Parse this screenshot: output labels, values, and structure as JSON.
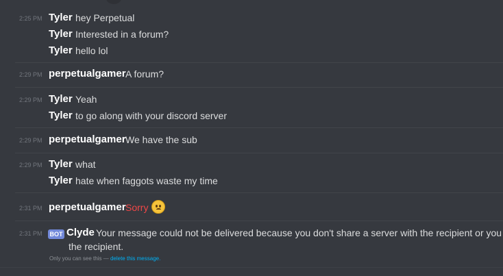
{
  "messages": [
    {
      "time": "2:25 PM",
      "author": "Tyler",
      "lines": [
        "hey Perpetual",
        "Interested in a forum?",
        "hello lol"
      ]
    },
    {
      "time": "2:29 PM",
      "author": "perpetualgamer",
      "lines": [
        "A forum?"
      ]
    },
    {
      "time": "2:29 PM",
      "author": "Tyler",
      "lines": [
        "Yeah",
        "to go along with your discord server"
      ]
    },
    {
      "time": "2:29 PM",
      "author": "perpetualgamer",
      "lines": [
        "We have the sub"
      ]
    },
    {
      "time": "2:29 PM",
      "author": "Tyler",
      "lines": [
        "what",
        "hate when faggots waste my time"
      ]
    },
    {
      "time": "2:31 PM",
      "author": "perpetualgamer",
      "lines": [
        "Sorry"
      ],
      "emoji": "worried-face-emoji",
      "text_color": "#f04747"
    },
    {
      "time": "2:31 PM",
      "author": "Clyde",
      "badge": "BOT",
      "lines": [
        "Your message could not be delivered because you don't share a server with the recipient or you",
        "the recipient."
      ],
      "ephemeral_note": "Only you can see this —",
      "ephemeral_link": "delete this message."
    }
  ],
  "colors": {
    "background": "#36393f",
    "author": "#ffffff",
    "text": "#dcddde",
    "timestamp": "#72767d",
    "bot_badge": "#7289da",
    "link": "#00b0f4",
    "error_text": "#f04747"
  }
}
